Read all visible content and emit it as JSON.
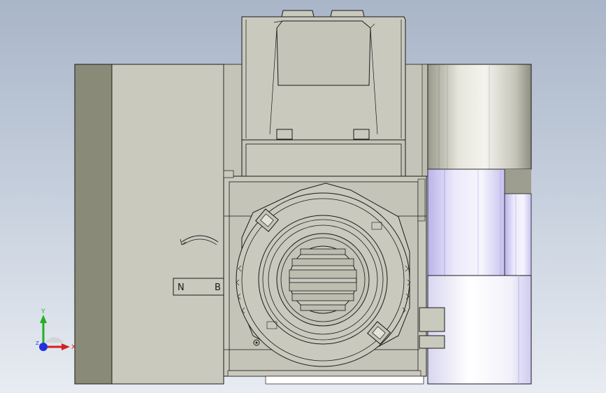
{
  "viewport": {
    "background_top": "#a9b5c8",
    "background_bottom": "#e8ecf2"
  },
  "model": {
    "body_color": "#c9c9be",
    "shade_color": "#8a8a78",
    "line_color": "#1a1a1a",
    "purple_highlight": "#c8c4f2",
    "plate_label_left": "N",
    "plate_label_right": "B"
  },
  "triad": {
    "y_label": "Y",
    "x_label": "X",
    "z_label": "Z",
    "y_color": "#22b022",
    "x_color": "#d42020",
    "z_color": "#2030e0"
  }
}
